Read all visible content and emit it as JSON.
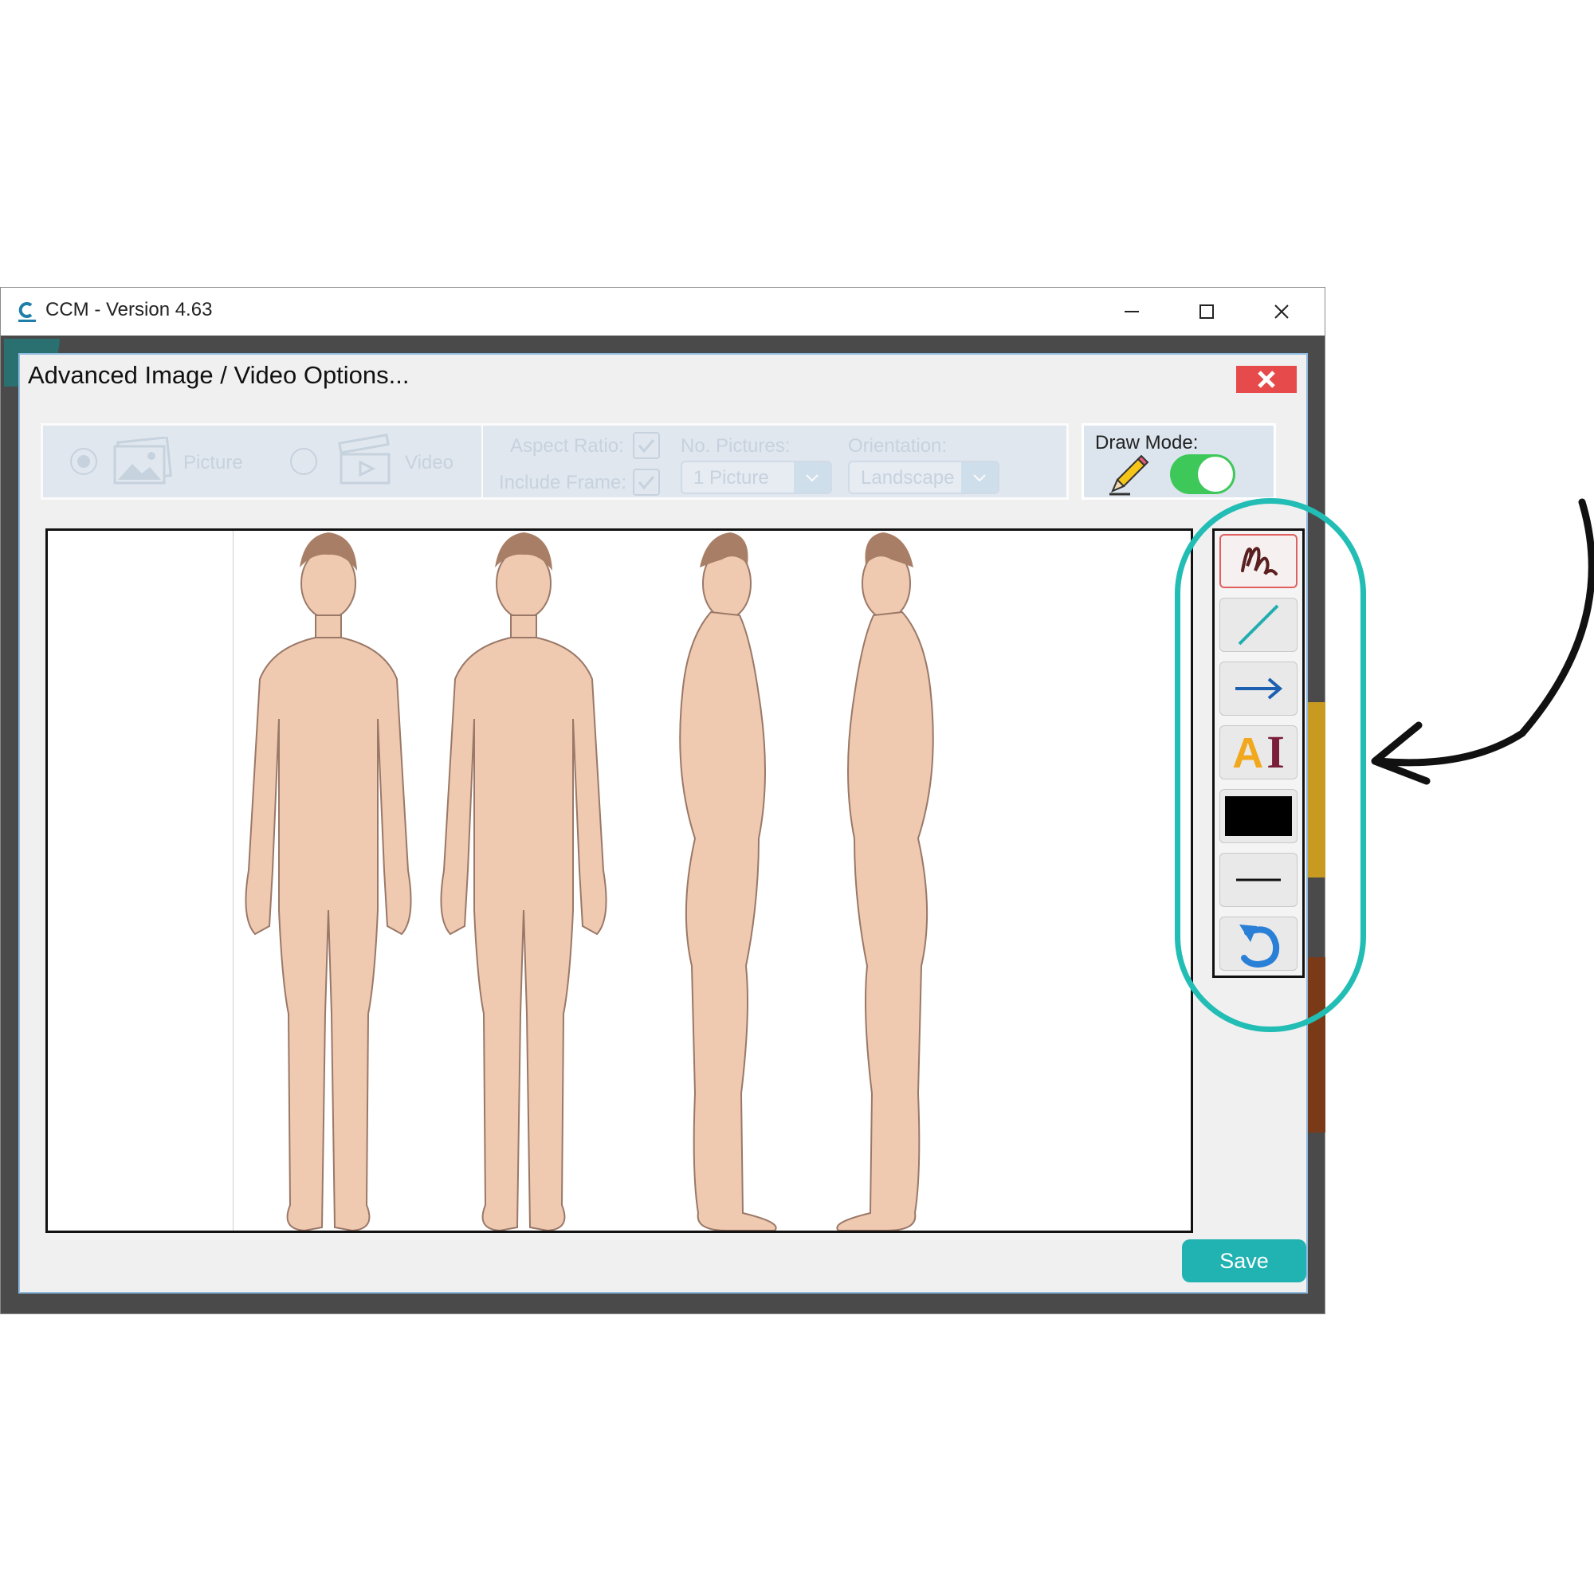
{
  "window": {
    "title": "CCM - Version 4.63",
    "logo_icon": "ccm-logo-icon",
    "controls": [
      "minimize-icon",
      "maximize-icon",
      "close-icon"
    ]
  },
  "dialog": {
    "title": "Advanced Image / Video Options...",
    "close_icon": "close-icon",
    "close_color": "#e64a4a"
  },
  "options": {
    "media_types": [
      {
        "label": "Picture",
        "selected": true,
        "icon": "picture-icon"
      },
      {
        "label": "Video",
        "selected": false,
        "icon": "video-clapper-icon"
      }
    ],
    "aspect_ratio_label": "Aspect Ratio:",
    "aspect_ratio_checked": true,
    "include_frame_label": "Include Frame:",
    "include_frame_checked": true,
    "no_pictures_label": "No. Pictures:",
    "no_pictures_value": "1 Picture",
    "orientation_label": "Orientation:",
    "orientation_value": "Landscape",
    "disabled": true
  },
  "draw_mode": {
    "label": "Draw Mode:",
    "icon": "pencil-icon",
    "enabled": true,
    "toggle_color": "#3ec85a"
  },
  "canvas": {
    "image": "body-chart-front-back-side-views"
  },
  "toolbar": {
    "tools": [
      {
        "name": "freehand-draw",
        "icon": "scribble-icon",
        "active": true
      },
      {
        "name": "straight-line",
        "icon": "line-icon",
        "active": false
      },
      {
        "name": "arrow",
        "icon": "arrow-icon",
        "active": false
      },
      {
        "name": "text",
        "icon": "text-icon",
        "active": false
      },
      {
        "name": "color",
        "icon": "color-swatch-icon",
        "active": false
      },
      {
        "name": "line-thickness",
        "icon": "line-width-icon",
        "active": false
      },
      {
        "name": "undo",
        "icon": "undo-icon",
        "active": false
      }
    ],
    "text_glyph_a": "A",
    "text_glyph_i": "I"
  },
  "save_button": {
    "label": "Save",
    "color": "#21b2b2"
  },
  "annotation": {
    "highlight_color": "#22bdb5"
  }
}
